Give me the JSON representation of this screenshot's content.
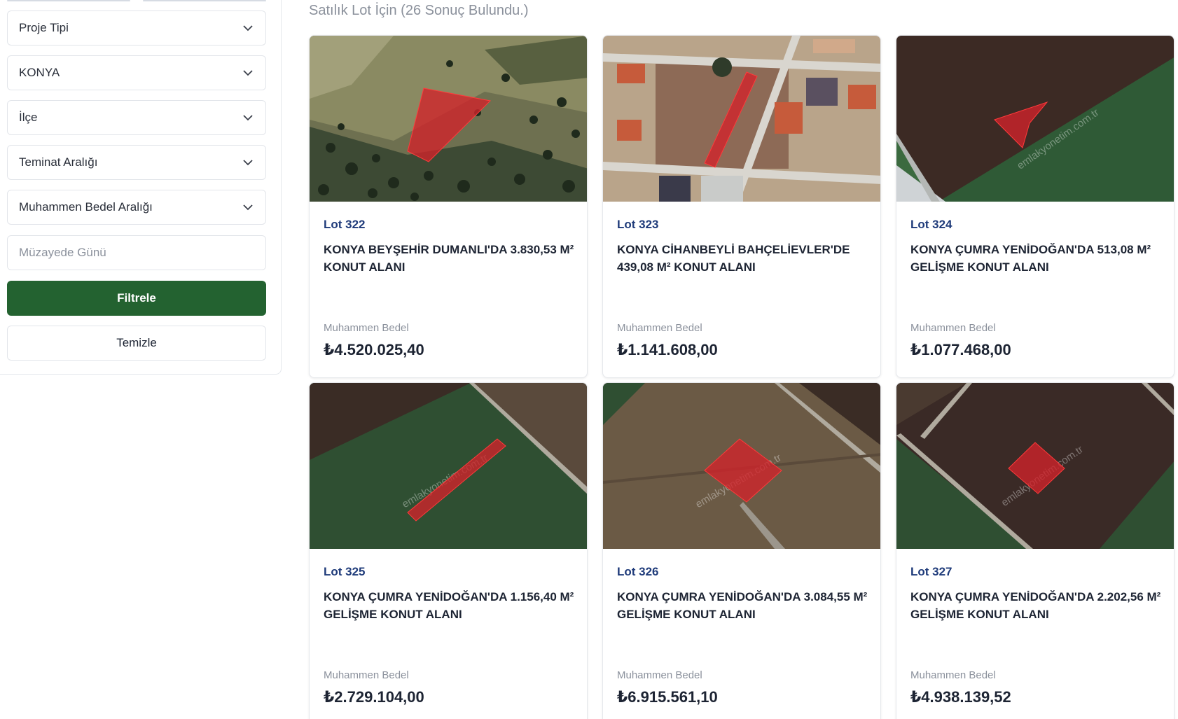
{
  "filters": {
    "project_type": "Proje Tipi",
    "city": "KONYA",
    "district": "İlçe",
    "guarantee_range": "Teminat Aralığı",
    "estimated_value_range": "Muhammen Bedel Aralığı",
    "auction_day_placeholder": "Müzayede Günü",
    "filter_button": "Filtrele",
    "clear_button": "Temizle"
  },
  "results": {
    "title": "Satılık Lot İçin (26 Sonuç Bulundu.)",
    "price_label": "Muhammen Bedel",
    "watermark": "emlakyonetim.com.tr",
    "items": [
      {
        "lot": "Lot 322",
        "title": "KONYA BEYŞEHİR DUMANLI'DA 3.830,53 M² KONUT ALANI",
        "price": "₺4.520.025,40"
      },
      {
        "lot": "Lot 323",
        "title": "KONYA CİHANBEYLİ BAHÇELİEVLER'DE 439,08 M² KONUT ALANI",
        "price": "₺1.141.608,00"
      },
      {
        "lot": "Lot 324",
        "title": "KONYA ÇUMRA YENİDOĞAN'DA 513,08 M² GELİŞME KONUT ALANI",
        "price": "₺1.077.468,00"
      },
      {
        "lot": "Lot 325",
        "title": "KONYA ÇUMRA YENİDOĞAN'DA 1.156,40 M² GELİŞME KONUT ALANI",
        "price": "₺2.729.104,00"
      },
      {
        "lot": "Lot 326",
        "title": "KONYA ÇUMRA YENİDOĞAN'DA 3.084,55 M² GELİŞME KONUT ALANI",
        "price": "₺6.915.561,10"
      },
      {
        "lot": "Lot 327",
        "title": "KONYA ÇUMRA YENİDOĞAN'DA 2.202,56 M² GELİŞME KONUT ALANI",
        "price": "₺4.938.139,52"
      }
    ]
  }
}
